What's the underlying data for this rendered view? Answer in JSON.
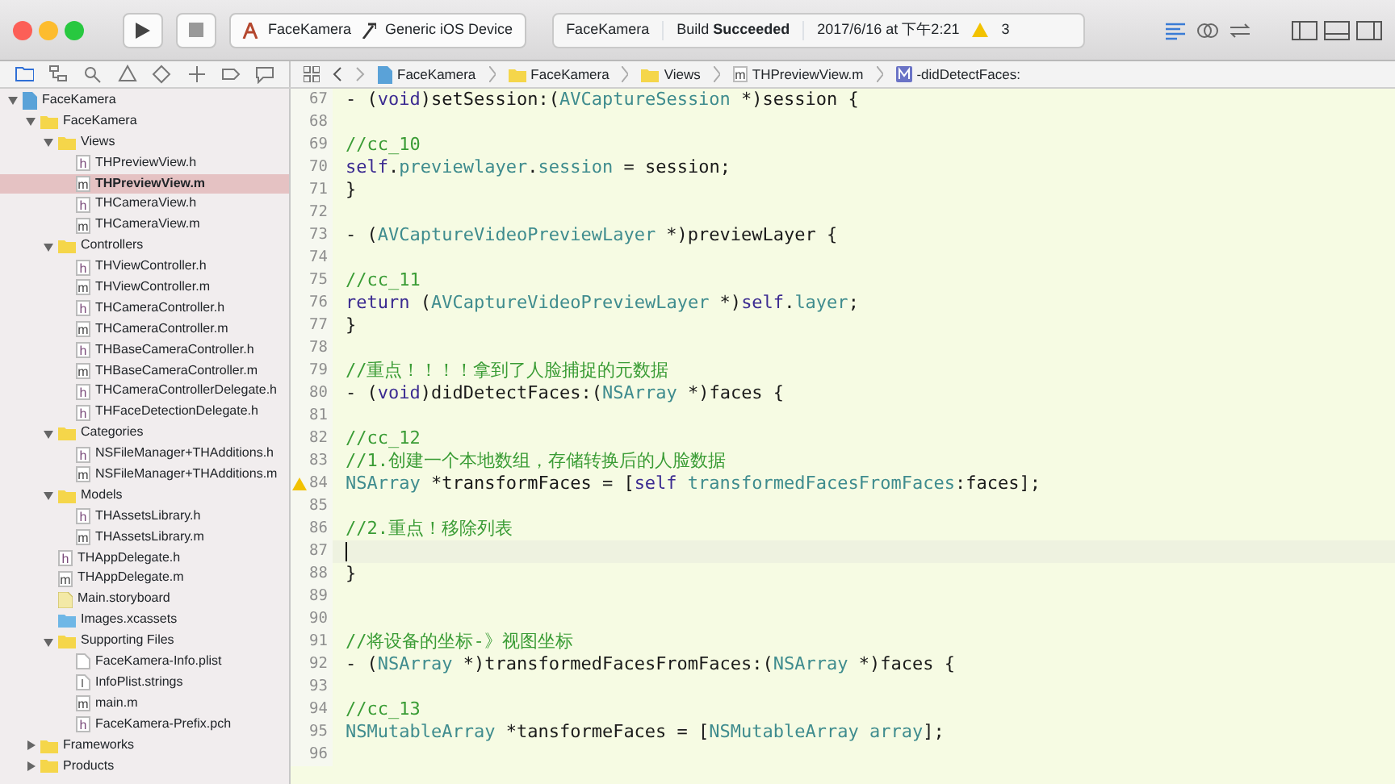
{
  "toolbar": {
    "scheme": "FaceKamera",
    "device": "Generic iOS Device",
    "status": {
      "project": "FaceKamera",
      "build": "Build **Succeeded**",
      "time": "2017/6/16 at 下午2:21",
      "warnings": "3"
    }
  },
  "navigator_tabs": [
    {
      "kind": "folder",
      "selected": true
    },
    {
      "kind": "hierarchy",
      "selected": false
    },
    {
      "kind": "search",
      "selected": false
    },
    {
      "kind": "warning",
      "selected": false
    },
    {
      "kind": "test",
      "selected": false
    },
    {
      "kind": "debug",
      "selected": false
    },
    {
      "kind": "breakpoint",
      "selected": false
    },
    {
      "kind": "report",
      "selected": false
    }
  ],
  "jump_bar": [
    {
      "kind": "project",
      "label": "FaceKamera"
    },
    {
      "kind": "folder",
      "label": "FaceKamera"
    },
    {
      "kind": "folder",
      "label": "Views"
    },
    {
      "kind": "m",
      "label": "THPreviewView.m"
    },
    {
      "kind": "method",
      "label": "-didDetectFaces:"
    }
  ],
  "sidebar": {
    "items": [
      {
        "kind": "project",
        "label": "FaceKamera",
        "expanded": true,
        "selected": false,
        "children": [
          {
            "kind": "folder",
            "label": "FaceKamera",
            "expanded": true,
            "selected": false,
            "children": [
              {
                "kind": "folder",
                "label": "Views",
                "expanded": true,
                "selected": false,
                "children": [
                  {
                    "kind": "h",
                    "label": "THPreviewView.h",
                    "selected": false
                  },
                  {
                    "kind": "m",
                    "label": "THPreviewView.m",
                    "selected": true
                  },
                  {
                    "kind": "h",
                    "label": "THCameraView.h",
                    "selected": false
                  },
                  {
                    "kind": "m",
                    "label": "THCameraView.m",
                    "selected": false
                  }
                ]
              },
              {
                "kind": "folder",
                "label": "Controllers",
                "expanded": true,
                "selected": false,
                "children": [
                  {
                    "kind": "h",
                    "label": "THViewController.h",
                    "selected": false
                  },
                  {
                    "kind": "m",
                    "label": "THViewController.m",
                    "selected": false
                  },
                  {
                    "kind": "h",
                    "label": "THCameraController.h",
                    "selected": false
                  },
                  {
                    "kind": "m",
                    "label": "THCameraController.m",
                    "selected": false
                  },
                  {
                    "kind": "h",
                    "label": "THBaseCameraController.h",
                    "selected": false
                  },
                  {
                    "kind": "m",
                    "label": "THBaseCameraController.m",
                    "selected": false
                  },
                  {
                    "kind": "h",
                    "label": "THCameraControllerDelegate.h",
                    "selected": false
                  },
                  {
                    "kind": "h",
                    "label": "THFaceDetectionDelegate.h",
                    "selected": false
                  }
                ]
              },
              {
                "kind": "folder",
                "label": "Categories",
                "expanded": true,
                "selected": false,
                "children": [
                  {
                    "kind": "h",
                    "label": "NSFileManager+THAdditions.h",
                    "selected": false
                  },
                  {
                    "kind": "m",
                    "label": "NSFileManager+THAdditions.m",
                    "selected": false
                  }
                ]
              },
              {
                "kind": "folder",
                "label": "Models",
                "expanded": true,
                "selected": false,
                "children": [
                  {
                    "kind": "h",
                    "label": "THAssetsLibrary.h",
                    "selected": false
                  },
                  {
                    "kind": "m",
                    "label": "THAssetsLibrary.m",
                    "selected": false
                  }
                ]
              },
              {
                "kind": "h",
                "label": "THAppDelegate.h",
                "selected": false
              },
              {
                "kind": "m",
                "label": "THAppDelegate.m",
                "selected": false
              },
              {
                "kind": "storyboard",
                "label": "Main.storyboard",
                "selected": false
              },
              {
                "kind": "assets",
                "label": "Images.xcassets",
                "selected": false
              },
              {
                "kind": "folder",
                "label": "Supporting Files",
                "expanded": true,
                "selected": false,
                "children": [
                  {
                    "kind": "plist",
                    "label": "FaceKamera-Info.plist",
                    "selected": false
                  },
                  {
                    "kind": "strings",
                    "label": "InfoPlist.strings",
                    "selected": false
                  },
                  {
                    "kind": "m",
                    "label": "main.m",
                    "selected": false
                  },
                  {
                    "kind": "h",
                    "label": "FaceKamera-Prefix.pch",
                    "selected": false
                  }
                ]
              }
            ]
          },
          {
            "kind": "folder",
            "label": "Frameworks",
            "expanded": false,
            "selected": false
          },
          {
            "kind": "folder",
            "label": "Products",
            "expanded": false,
            "selected": false
          }
        ]
      }
    ]
  },
  "editor": {
    "lines": [
      {
        "number": "67",
        "tokens": [
          {
            "kind": "plain",
            "text": "- ("
          },
          {
            "kind": "keyword",
            "text": "void"
          },
          {
            "kind": "plain",
            "text": ")setSession:("
          },
          {
            "kind": "type",
            "text": "AVCaptureSession"
          },
          {
            "kind": "plain",
            "text": " *)session {"
          }
        ]
      },
      {
        "number": "68"
      },
      {
        "number": "69",
        "indented": true,
        "tokens": [
          {
            "kind": "comment",
            "text": "//cc_10"
          }
        ]
      },
      {
        "number": "70",
        "indented": true,
        "tokens": [
          {
            "kind": "keyword",
            "text": "self"
          },
          {
            "kind": "plain",
            "text": "."
          },
          {
            "kind": "type",
            "text": "previewlayer"
          },
          {
            "kind": "plain",
            "text": "."
          },
          {
            "kind": "type",
            "text": "session"
          },
          {
            "kind": "plain",
            "text": " = session;"
          }
        ]
      },
      {
        "number": "71",
        "tokens": [
          {
            "kind": "plain",
            "text": "}"
          }
        ]
      },
      {
        "number": "72"
      },
      {
        "number": "73",
        "tokens": [
          {
            "kind": "plain",
            "text": "- ("
          },
          {
            "kind": "type",
            "text": "AVCaptureVideoPreviewLayer"
          },
          {
            "kind": "plain",
            "text": " *)previewLayer {"
          }
        ]
      },
      {
        "number": "74"
      },
      {
        "number": "75",
        "indented": true,
        "tokens": [
          {
            "kind": "comment",
            "text": "//cc_11"
          }
        ]
      },
      {
        "number": "76",
        "indented": true,
        "tokens": [
          {
            "kind": "keyword",
            "text": "return"
          },
          {
            "kind": "plain",
            "text": " ("
          },
          {
            "kind": "type",
            "text": "AVCaptureVideoPreviewLayer"
          },
          {
            "kind": "plain",
            "text": " *)"
          },
          {
            "kind": "keyword",
            "text": "self"
          },
          {
            "kind": "plain",
            "text": "."
          },
          {
            "kind": "type",
            "text": "layer"
          },
          {
            "kind": "plain",
            "text": ";"
          }
        ]
      },
      {
        "number": "77",
        "tokens": [
          {
            "kind": "plain",
            "text": "}"
          }
        ]
      },
      {
        "number": "78"
      },
      {
        "number": "79",
        "tokens": [
          {
            "kind": "comment",
            "text": "//重点！！！！拿到了人脸捕捉的元数据"
          }
        ]
      },
      {
        "number": "80",
        "tokens": [
          {
            "kind": "plain",
            "text": "- ("
          },
          {
            "kind": "keyword",
            "text": "void"
          },
          {
            "kind": "plain",
            "text": ")didDetectFaces:("
          },
          {
            "kind": "type",
            "text": "NSArray"
          },
          {
            "kind": "plain",
            "text": " *)faces {"
          }
        ]
      },
      {
        "number": "81"
      },
      {
        "number": "82",
        "indented": true,
        "tokens": [
          {
            "kind": "comment",
            "text": "//cc_12"
          }
        ]
      },
      {
        "number": "83",
        "indented": true,
        "tokens": [
          {
            "kind": "comment",
            "text": "//1.创建一个本地数组，存储转换后的人脸数据"
          }
        ]
      },
      {
        "number": "84",
        "indented": true,
        "warning": true,
        "tokens": [
          {
            "kind": "type",
            "text": "NSArray"
          },
          {
            "kind": "plain",
            "text": " *transformFaces = ["
          },
          {
            "kind": "keyword",
            "text": "self"
          },
          {
            "kind": "type",
            "text": " transformedFacesFromFaces"
          },
          {
            "kind": "plain",
            "text": ":faces];"
          }
        ]
      },
      {
        "number": "85"
      },
      {
        "number": "86",
        "indented": true,
        "tokens": [
          {
            "kind": "comment",
            "text": "//2.重点！移除列表"
          }
        ]
      },
      {
        "number": "87",
        "indented": true,
        "current": true
      },
      {
        "number": "88",
        "tokens": [
          {
            "kind": "plain",
            "text": "}"
          }
        ]
      },
      {
        "number": "89"
      },
      {
        "number": "90"
      },
      {
        "number": "91",
        "tokens": [
          {
            "kind": "comment",
            "text": "//将设备的坐标-》视图坐标"
          }
        ]
      },
      {
        "number": "92",
        "tokens": [
          {
            "kind": "plain",
            "text": "- ("
          },
          {
            "kind": "type",
            "text": "NSArray"
          },
          {
            "kind": "plain",
            "text": " *)transformedFacesFromFaces:("
          },
          {
            "kind": "type",
            "text": "NSArray"
          },
          {
            "kind": "plain",
            "text": " *)faces {"
          }
        ]
      },
      {
        "number": "93"
      },
      {
        "number": "94",
        "indented": true,
        "tokens": [
          {
            "kind": "comment",
            "text": "//cc_13"
          }
        ]
      },
      {
        "number": "95",
        "indented": true,
        "tokens": [
          {
            "kind": "type",
            "text": "NSMutableArray"
          },
          {
            "kind": "plain",
            "text": " *tansformeFaces = ["
          },
          {
            "kind": "type",
            "text": "NSMutableArray"
          },
          {
            "kind": "type",
            "text": " array"
          },
          {
            "kind": "plain",
            "text": "];"
          }
        ]
      },
      {
        "number": "96"
      }
    ]
  }
}
